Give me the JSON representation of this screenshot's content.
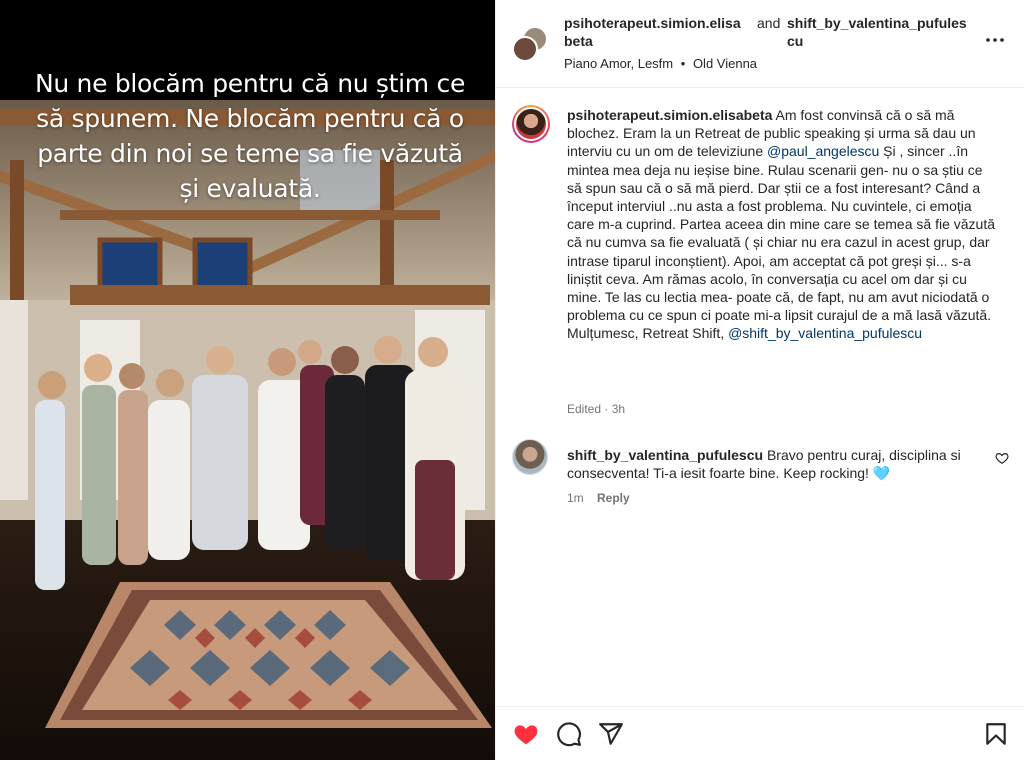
{
  "media": {
    "overlay_text": "Nu ne blocăm pentru că nu știm ce să spunem. Ne blocăm pentru că o parte din noi se teme sa fie văzută și evaluată."
  },
  "header": {
    "author": "psihoterapeut.simion.elisabeta",
    "connector": "and",
    "collaborator": "shift_by_valentina_pufulescu",
    "audio": "Piano Amor, Lesfm",
    "location": "Old Vienna",
    "separator": "•",
    "more_icon": "more-horizontal-icon"
  },
  "caption": {
    "username": "psihoterapeut.simion.elisabeta",
    "text_1": " Am fost convinsă că o să mă blochez. Eram la un Retreat de public speaking și urma să dau un interviu cu un om de televiziune ",
    "mention_1": "@paul_angelescu",
    "text_2": " Și , sincer ..în mintea mea deja nu ieșise bine. Rulau scenarii gen- nu o sa știu ce să spun sau că o să mă pierd. Dar știi ce a fost interesant? Când a început interviul ..nu asta a fost problema. Nu cuvintele, ci emoția care m-a cuprind. Partea aceea din mine care se temea să fie văzută că nu cumva sa fie evaluată ( și chiar nu era cazul in acest grup, dar intrase tiparul inconștient). Apoi, am acceptat că pot greși și... s-a liniștit ceva. Am rămas acolo, în conversația cu acel om dar și cu mine. Te las cu lectia mea- poate că, de fapt, nu am avut niciodată o problema cu ce spun ci poate mi-a lipsit curajul de a mă lasă văzută. Mulțumesc, Retreat Shift, ",
    "mention_2": "@shift_by_valentina_pufulescu",
    "edited": "Edited",
    "time": "3h"
  },
  "reply": {
    "username": "shift_by_valentina_pufulescu",
    "text": " Bravo pentru curaj, disciplina si consecventa! Ti-a iesit foarte bine. Keep rocking! 🩵",
    "time": "1m",
    "reply_label": "Reply",
    "like_icon": "heart-outline-icon"
  },
  "actions": {
    "like_icon": "heart-filled-icon",
    "comment_icon": "comment-icon",
    "share_icon": "share-icon",
    "save_icon": "bookmark-icon",
    "like_color": "#ff3040"
  }
}
